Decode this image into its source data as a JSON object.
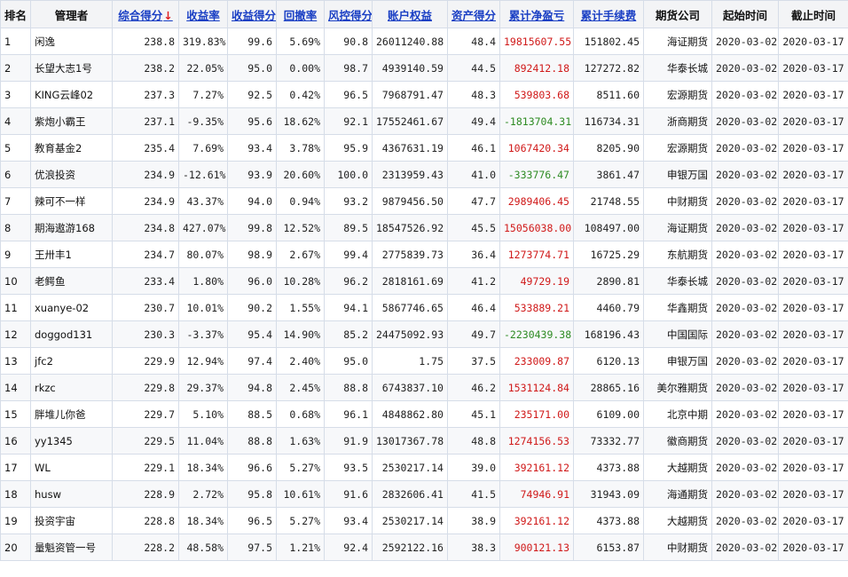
{
  "headers": {
    "rank": "排名",
    "manager": "管理者",
    "total_score": "综合得分",
    "total_score_sort_icon": "↓",
    "return_rate": "收益率",
    "return_score": "收益得分",
    "drawdown": "回撤率",
    "risk_score": "风控得分",
    "equity": "账户权益",
    "asset_score": "资产得分",
    "cum_pnl": "累计净盈亏",
    "cum_fee": "累计手续费",
    "company": "期货公司",
    "start": "起始时间",
    "end": "截止时间"
  },
  "colors": {
    "link": "#1a3fc4",
    "positive": "#d01919",
    "negative": "#2e8b23",
    "sort_arrow": "#e02020"
  },
  "rows": [
    {
      "rank": "1",
      "name": "闲逸",
      "score": "238.8",
      "ret": "319.83%",
      "ret_score": "99.6",
      "dd": "5.69%",
      "risk": "90.8",
      "equity": "26011240.88",
      "asset": "48.4",
      "pnl": "19815607.55",
      "fee": "151802.45",
      "company": "海证期货",
      "start": "2020-03-02",
      "end": "2020-03-17"
    },
    {
      "rank": "2",
      "name": "长望大志1号",
      "score": "238.2",
      "ret": "22.05%",
      "ret_score": "95.0",
      "dd": "0.00%",
      "risk": "98.7",
      "equity": "4939140.59",
      "asset": "44.5",
      "pnl": "892412.18",
      "fee": "127272.82",
      "company": "华泰长城",
      "start": "2020-03-02",
      "end": "2020-03-17"
    },
    {
      "rank": "3",
      "name": "KING云峰02",
      "score": "237.3",
      "ret": "7.27%",
      "ret_score": "92.5",
      "dd": "0.42%",
      "risk": "96.5",
      "equity": "7968791.47",
      "asset": "48.3",
      "pnl": "539803.68",
      "fee": "8511.60",
      "company": "宏源期货",
      "start": "2020-03-02",
      "end": "2020-03-17"
    },
    {
      "rank": "4",
      "name": "紫炮小霸王",
      "score": "237.1",
      "ret": "-9.35%",
      "ret_score": "95.6",
      "dd": "18.62%",
      "risk": "92.1",
      "equity": "17552461.67",
      "asset": "49.4",
      "pnl": "-1813704.31",
      "fee": "116734.31",
      "company": "浙商期货",
      "start": "2020-03-02",
      "end": "2020-03-17"
    },
    {
      "rank": "5",
      "name": "教育基金2",
      "score": "235.4",
      "ret": "7.69%",
      "ret_score": "93.4",
      "dd": "3.78%",
      "risk": "95.9",
      "equity": "4367631.19",
      "asset": "46.1",
      "pnl": "1067420.34",
      "fee": "8205.90",
      "company": "宏源期货",
      "start": "2020-03-02",
      "end": "2020-03-17"
    },
    {
      "rank": "6",
      "name": "优浪投资",
      "score": "234.9",
      "ret": "-12.61%",
      "ret_score": "93.9",
      "dd": "20.60%",
      "risk": "100.0",
      "equity": "2313959.43",
      "asset": "41.0",
      "pnl": "-333776.47",
      "fee": "3861.47",
      "company": "申银万国",
      "start": "2020-03-02",
      "end": "2020-03-17"
    },
    {
      "rank": "7",
      "name": "辣可不一样",
      "score": "234.9",
      "ret": "43.37%",
      "ret_score": "94.0",
      "dd": "0.94%",
      "risk": "93.2",
      "equity": "9879456.50",
      "asset": "47.7",
      "pnl": "2989406.45",
      "fee": "21748.55",
      "company": "中财期货",
      "start": "2020-03-02",
      "end": "2020-03-17"
    },
    {
      "rank": "8",
      "name": "期海遨游168",
      "score": "234.8",
      "ret": "427.07%",
      "ret_score": "99.8",
      "dd": "12.52%",
      "risk": "89.5",
      "equity": "18547526.92",
      "asset": "45.5",
      "pnl": "15056038.00",
      "fee": "108497.00",
      "company": "海证期货",
      "start": "2020-03-02",
      "end": "2020-03-17"
    },
    {
      "rank": "9",
      "name": "王卅丰1",
      "score": "234.7",
      "ret": "80.07%",
      "ret_score": "98.9",
      "dd": "2.67%",
      "risk": "99.4",
      "equity": "2775839.73",
      "asset": "36.4",
      "pnl": "1273774.71",
      "fee": "16725.29",
      "company": "东航期货",
      "start": "2020-03-02",
      "end": "2020-03-17"
    },
    {
      "rank": "10",
      "name": "老鳄鱼",
      "score": "233.4",
      "ret": "1.80%",
      "ret_score": "96.0",
      "dd": "10.28%",
      "risk": "96.2",
      "equity": "2818161.69",
      "asset": "41.2",
      "pnl": "49729.19",
      "fee": "2890.81",
      "company": "华泰长城",
      "start": "2020-03-02",
      "end": "2020-03-17"
    },
    {
      "rank": "11",
      "name": "xuanye-02",
      "score": "230.7",
      "ret": "10.01%",
      "ret_score": "90.2",
      "dd": "1.55%",
      "risk": "94.1",
      "equity": "5867746.65",
      "asset": "46.4",
      "pnl": "533889.21",
      "fee": "4460.79",
      "company": "华鑫期货",
      "start": "2020-03-02",
      "end": "2020-03-17"
    },
    {
      "rank": "12",
      "name": "doggod131",
      "score": "230.3",
      "ret": "-3.37%",
      "ret_score": "95.4",
      "dd": "14.90%",
      "risk": "85.2",
      "equity": "24475092.93",
      "asset": "49.7",
      "pnl": "-2230439.38",
      "fee": "168196.43",
      "company": "中国国际",
      "start": "2020-03-02",
      "end": "2020-03-17"
    },
    {
      "rank": "13",
      "name": "jfc2",
      "score": "229.9",
      "ret": "12.94%",
      "ret_score": "97.4",
      "dd": "2.40%",
      "risk": "95.0",
      "equity": "1.75",
      "asset": "37.5",
      "pnl": "233009.87",
      "fee": "6120.13",
      "company": "申银万国",
      "start": "2020-03-02",
      "end": "2020-03-17"
    },
    {
      "rank": "14",
      "name": "rkzc",
      "score": "229.8",
      "ret": "29.37%",
      "ret_score": "94.8",
      "dd": "2.45%",
      "risk": "88.8",
      "equity": "6743837.10",
      "asset": "46.2",
      "pnl": "1531124.84",
      "fee": "28865.16",
      "company": "美尔雅期货",
      "start": "2020-03-02",
      "end": "2020-03-17"
    },
    {
      "rank": "15",
      "name": "胖堆儿你爸",
      "score": "229.7",
      "ret": "5.10%",
      "ret_score": "88.5",
      "dd": "0.68%",
      "risk": "96.1",
      "equity": "4848862.80",
      "asset": "45.1",
      "pnl": "235171.00",
      "fee": "6109.00",
      "company": "北京中期",
      "start": "2020-03-02",
      "end": "2020-03-17"
    },
    {
      "rank": "16",
      "name": "yy1345",
      "score": "229.5",
      "ret": "11.04%",
      "ret_score": "88.8",
      "dd": "1.63%",
      "risk": "91.9",
      "equity": "13017367.78",
      "asset": "48.8",
      "pnl": "1274156.53",
      "fee": "73332.77",
      "company": "徽商期货",
      "start": "2020-03-02",
      "end": "2020-03-17"
    },
    {
      "rank": "17",
      "name": "WL",
      "score": "229.1",
      "ret": "18.34%",
      "ret_score": "96.6",
      "dd": "5.27%",
      "risk": "93.5",
      "equity": "2530217.14",
      "asset": "39.0",
      "pnl": "392161.12",
      "fee": "4373.88",
      "company": "大越期货",
      "start": "2020-03-02",
      "end": "2020-03-17"
    },
    {
      "rank": "18",
      "name": "husw",
      "score": "228.9",
      "ret": "2.72%",
      "ret_score": "95.8",
      "dd": "10.61%",
      "risk": "91.6",
      "equity": "2832606.41",
      "asset": "41.5",
      "pnl": "74946.91",
      "fee": "31943.09",
      "company": "海通期货",
      "start": "2020-03-02",
      "end": "2020-03-17"
    },
    {
      "rank": "19",
      "name": "投资宇宙",
      "score": "228.8",
      "ret": "18.34%",
      "ret_score": "96.5",
      "dd": "5.27%",
      "risk": "93.4",
      "equity": "2530217.14",
      "asset": "38.9",
      "pnl": "392161.12",
      "fee": "4373.88",
      "company": "大越期货",
      "start": "2020-03-02",
      "end": "2020-03-17"
    },
    {
      "rank": "20",
      "name": "量魁资管一号",
      "score": "228.2",
      "ret": "48.58%",
      "ret_score": "97.5",
      "dd": "1.21%",
      "risk": "92.4",
      "equity": "2592122.16",
      "asset": "38.3",
      "pnl": "900121.13",
      "fee": "6153.87",
      "company": "中财期货",
      "start": "2020-03-02",
      "end": "2020-03-17"
    }
  ]
}
